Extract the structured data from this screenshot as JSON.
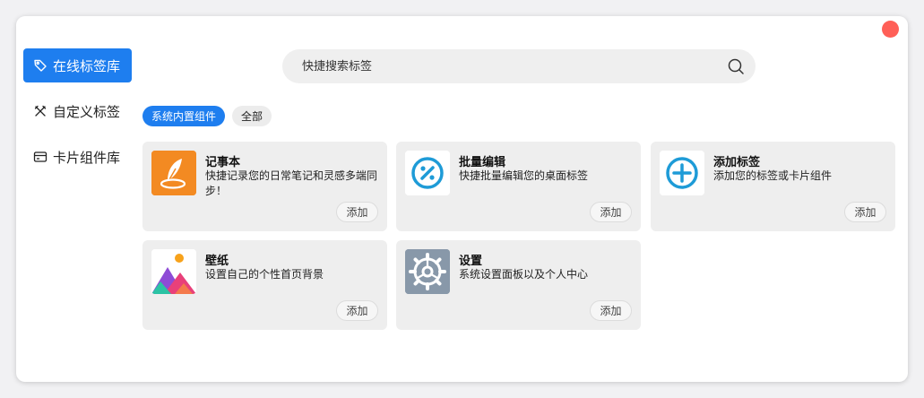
{
  "sidebar": {
    "items": [
      {
        "label": "在线标签库",
        "icon": "tag-icon",
        "active": true
      },
      {
        "label": "自定义标签",
        "icon": "tools-icon",
        "active": false
      },
      {
        "label": "卡片组件库",
        "icon": "card-icon",
        "active": false
      }
    ]
  },
  "search": {
    "placeholder": "快捷搜索标签",
    "icon": "search-icon"
  },
  "filters": [
    {
      "label": "系统内置组件",
      "active": true
    },
    {
      "label": "全部",
      "active": false
    }
  ],
  "cards": [
    {
      "title": "记事本",
      "desc": "快捷记录您的日常笔记和灵感多端同步！",
      "add_label": "添加",
      "icon": "notepad-icon"
    },
    {
      "title": "批量编辑",
      "desc": "快捷批量编辑您的桌面标签",
      "add_label": "添加",
      "icon": "batch-edit-icon"
    },
    {
      "title": "添加标签",
      "desc": "添加您的标签或卡片组件",
      "add_label": "添加",
      "icon": "add-tag-icon"
    },
    {
      "title": "壁纸",
      "desc": "设置自己的个性首页背景",
      "add_label": "添加",
      "icon": "wallpaper-icon"
    },
    {
      "title": "设置",
      "desc": "系统设置面板以及个人中心",
      "add_label": "添加",
      "icon": "settings-icon"
    }
  ],
  "colors": {
    "accent": "#1e7eef",
    "close": "#ff5f57",
    "card_bg": "#eeeeee"
  }
}
